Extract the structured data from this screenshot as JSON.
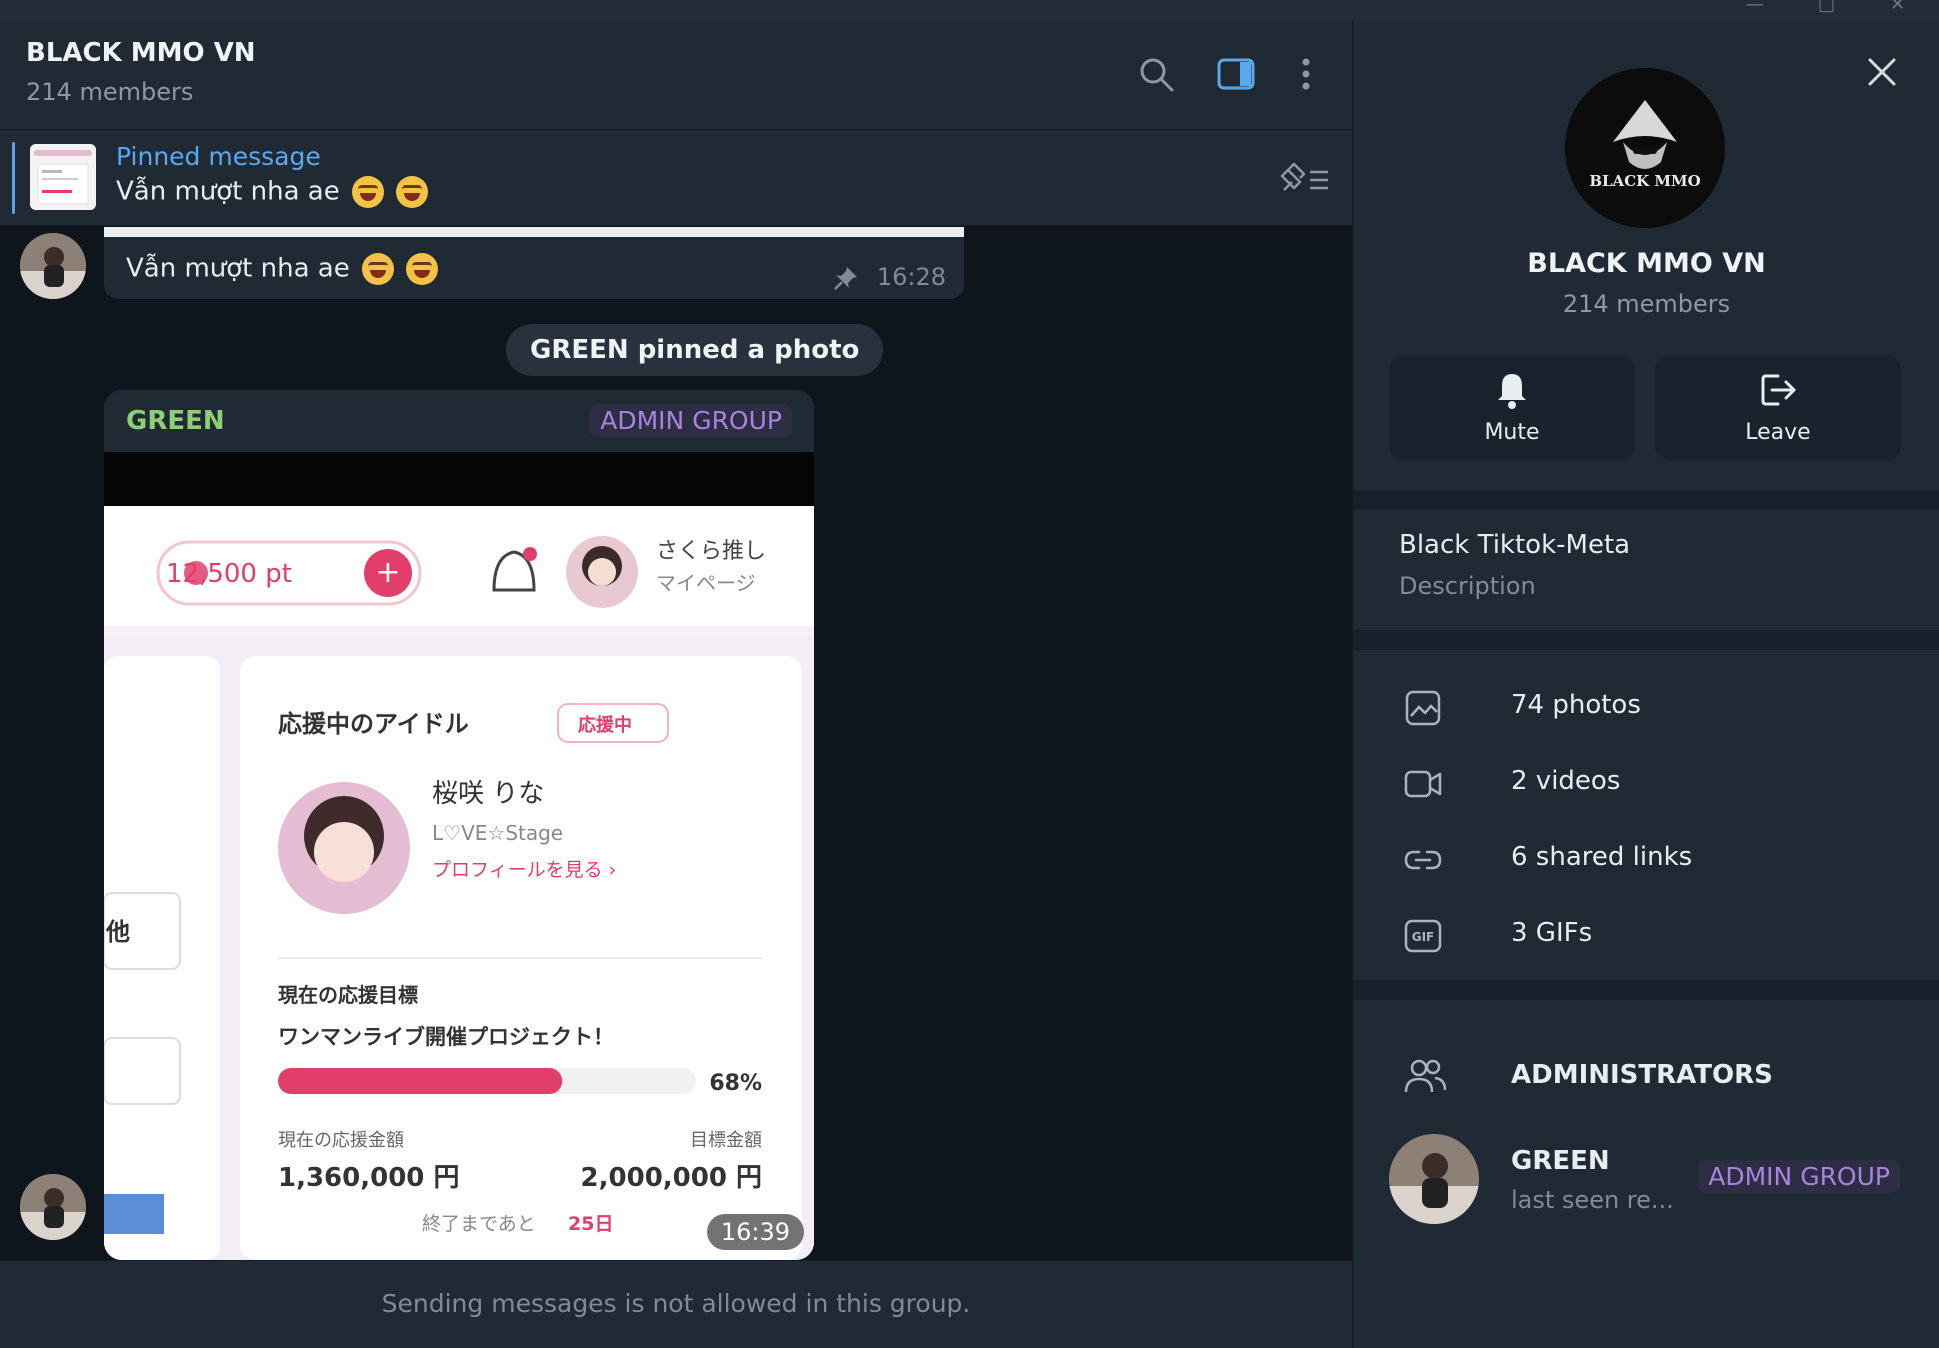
{
  "chat": {
    "title": "BLACK MMO VN",
    "members": "214 members",
    "pinned": {
      "title": "Pinned message",
      "text": "Vẫn mượt nha ae"
    },
    "messages": {
      "first": {
        "text": "Vẫn mượt nha ae",
        "time": "16:28"
      },
      "service": "GREEN pinned a photo",
      "photo": {
        "sender": "GREEN",
        "badge": "ADMIN GROUP",
        "time": "16:39",
        "image_texts": {
          "points": "12,500 pt",
          "oshi": "さくら推し",
          "mypage": "マイページ",
          "section": "応援中のアイドル",
          "supporting": "応援中",
          "idol_name": "桜咲 りな",
          "group": "L♡VE☆Stage",
          "profile_link": "プロフィールを見る ›",
          "goal_label": "現在の応援目標",
          "project": "ワンマンライブ開催プロジェクト！",
          "progress_pct": "68%",
          "progress": 0.68,
          "current_label": "現在の応援金額",
          "target_label": "目標金額",
          "current_amount": "1,360,000 円",
          "target_amount": "2,000,000 円",
          "remaining": "終了まであと",
          "days": "25日",
          "side_char": "他"
        }
      }
    },
    "footer": "Sending messages is not allowed in this group."
  },
  "panel": {
    "title": "BLACK MMO VN",
    "members": "214 members",
    "logo_text": "BLACK MMO",
    "actions": [
      {
        "label": "Mute",
        "icon": "bell-icon"
      },
      {
        "label": "Leave",
        "icon": "leave-icon"
      }
    ],
    "description": {
      "text": "Black Tiktok-Meta",
      "label": "Description"
    },
    "media": [
      {
        "label": "74 photos",
        "icon": "photo-icon"
      },
      {
        "label": "2 videos",
        "icon": "video-icon"
      },
      {
        "label": "6 shared links",
        "icon": "link-icon"
      },
      {
        "label": "3 GIFs",
        "icon": "gif-icon"
      }
    ],
    "admins": {
      "heading": "ADMINISTRATORS",
      "list": [
        {
          "name": "GREEN",
          "status": "last seen re...",
          "badge": "ADMIN GROUP"
        }
      ]
    }
  },
  "colors": {
    "accent": "#5aa9ef",
    "sender_green": "#8fcf74",
    "admin_badge": "#a883df"
  }
}
